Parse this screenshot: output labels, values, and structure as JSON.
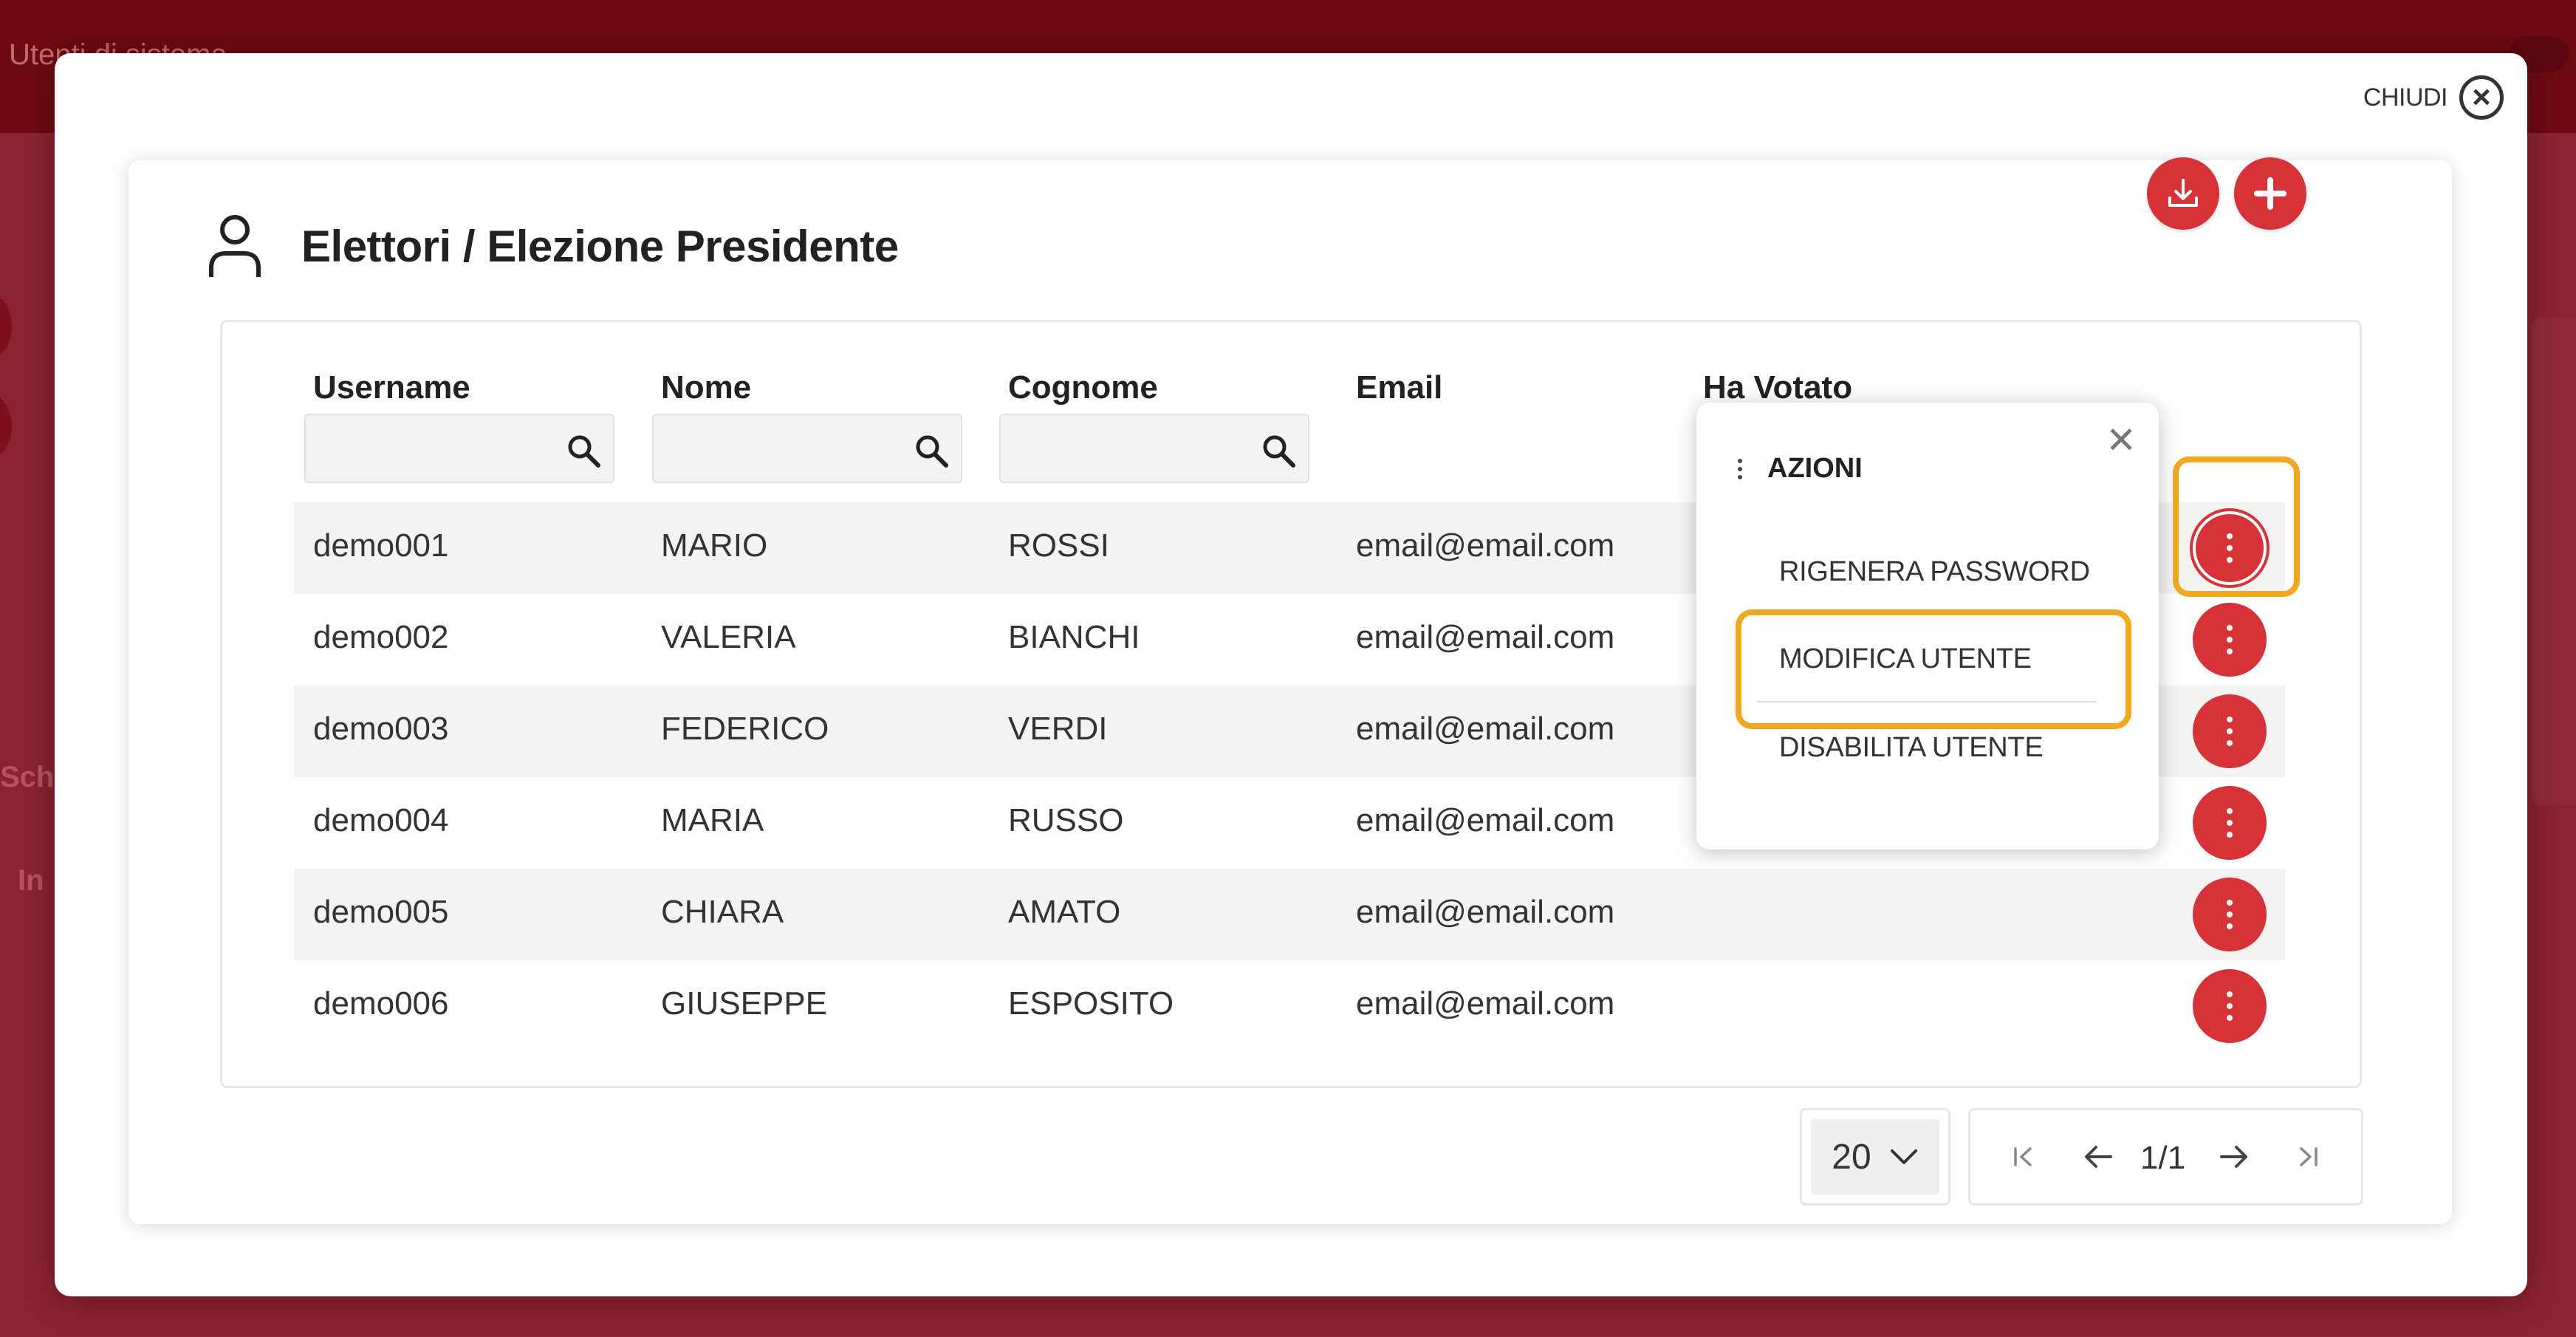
{
  "background": {
    "title": "Utenti di sistema",
    "text_a": "Sch",
    "text_b": "In"
  },
  "modal": {
    "close_label": "CHIUDI",
    "title": "Elettori / Elezione Presidente"
  },
  "table": {
    "columns": [
      "Username",
      "Nome",
      "Cognome",
      "Email",
      "Ha Votato"
    ],
    "rows": [
      {
        "username": "demo001",
        "nome": "MARIO",
        "cognome": "ROSSI",
        "email": "email@email.com"
      },
      {
        "username": "demo002",
        "nome": "VALERIA",
        "cognome": "BIANCHI",
        "email": "email@email.com"
      },
      {
        "username": "demo003",
        "nome": "FEDERICO",
        "cognome": "VERDI",
        "email": "email@email.com"
      },
      {
        "username": "demo004",
        "nome": "MARIA",
        "cognome": "RUSSO",
        "email": "email@email.com"
      },
      {
        "username": "demo005",
        "nome": "CHIARA",
        "cognome": "AMATO",
        "email": "email@email.com"
      },
      {
        "username": "demo006",
        "nome": "GIUSEPPE",
        "cognome": "ESPOSITO",
        "email": "email@email.com"
      }
    ]
  },
  "menu": {
    "title": "AZIONI",
    "items": [
      "RIGENERA PASSWORD",
      "MODIFICA UTENTE",
      "DISABILITA UTENTE"
    ]
  },
  "pagination": {
    "page_size": "20",
    "current": "1/1"
  },
  "colors": {
    "accent": "#d63237",
    "highlight": "#f0a820",
    "backdrop": "#7a1520"
  },
  "icons": [
    "user-icon",
    "download-icon",
    "plus-icon",
    "search-icon",
    "close-icon",
    "more-vertical-icon",
    "chevron-down-icon",
    "first-page-icon",
    "arrow-left-icon",
    "arrow-right-icon",
    "last-page-icon"
  ]
}
